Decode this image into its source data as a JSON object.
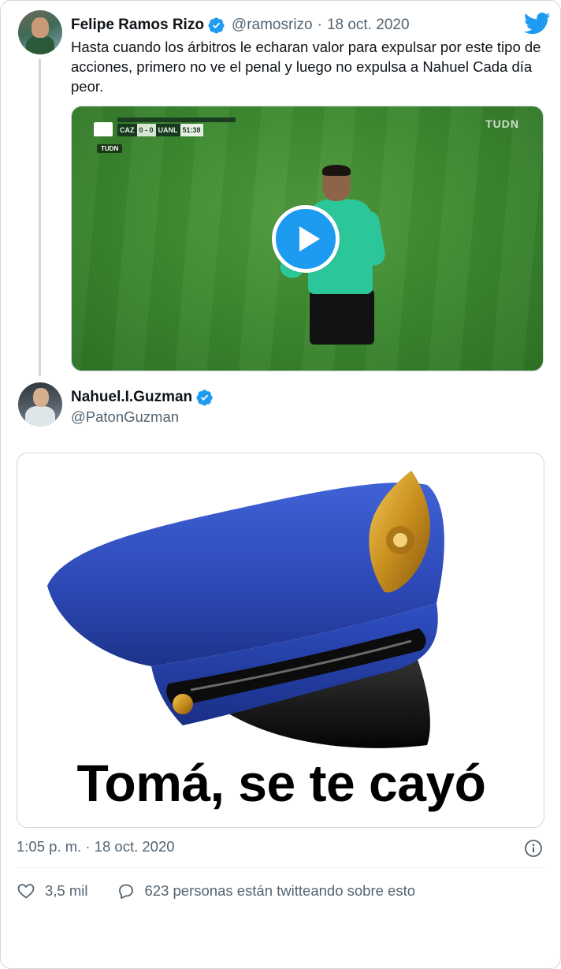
{
  "quoted_tweet": {
    "author_name": "Felipe Ramos Rizo",
    "handle": "@ramosrizo",
    "separator": "·",
    "date": "18 oct. 2020",
    "text": "Hasta cuando los árbitros le echaran valor  para expulsar por este tipo de acciones, primero no ve el penal y luego no expulsa a Nahuel Cada día peor.",
    "video": {
      "scorebug": {
        "home": "CAZ",
        "score": "0 - 0",
        "away": "UANL",
        "clock": "51:38",
        "tag": "TUDN"
      },
      "watermark": "TUDN"
    }
  },
  "tweet": {
    "author_name": "Nahuel.I.Guzman",
    "handle": "@PatonGuzman",
    "image_caption": "Tomá, se te cayó",
    "timestamp": "1:05 p. m. · 18 oct. 2020",
    "likes": "3,5 mil",
    "conversation": "623 personas están twitteando sobre esto"
  },
  "colors": {
    "accent": "#1d9bf0",
    "text": "#0f1419",
    "secondary": "#536471",
    "border": "#cfd9de"
  },
  "icons": [
    "twitter-logo-icon",
    "verified-badge-icon",
    "play-icon",
    "info-icon",
    "heart-icon",
    "reply-icon"
  ]
}
